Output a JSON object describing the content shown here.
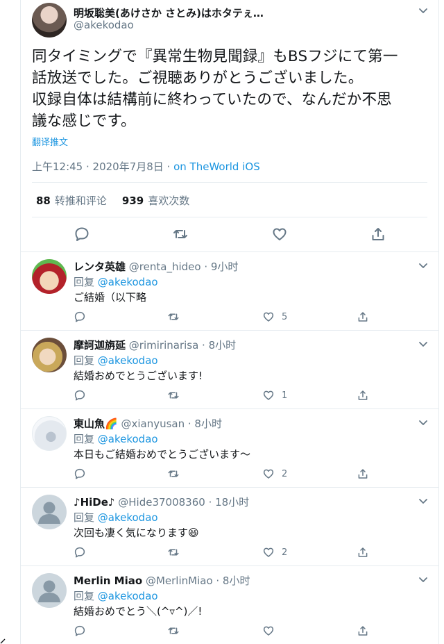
{
  "main_tweet": {
    "author_name": "明坂聡美(あけさか さとみ)はホタテぇ…",
    "author_handle": "@akekodao",
    "text_lines": [
      "同タイミングで『異常生物見聞録』もBSフジにて第一",
      "話放送でした。ご視聴ありがとうございました。",
      "収録自体は結構前に終わっていたので、なんだか不思",
      "議な感じです。"
    ],
    "translate_label": "翻译推文",
    "time": "上午12:45 · 2020年7月8日 · ",
    "via": "on TheWorld iOS",
    "retweets_count": "88",
    "retweets_label": "转推和评论",
    "likes_count": "939",
    "likes_label": "喜欢次数"
  },
  "replies": [
    {
      "name": "レンタ英雄",
      "handle": "@renta_hideo · 9小时",
      "reply_prefix": "回复 ",
      "mention": "@akekodao",
      "text": "ご結婚（以下略",
      "likes": "5",
      "avatar": "anime-avatar-red-hair"
    },
    {
      "name": "摩訶迦旃延",
      "handle": "@rimirinarisa · 8小时",
      "reply_prefix": "回复 ",
      "mention": "@akekodao",
      "text": "結婚おめでとうございます!",
      "likes": "1",
      "avatar": "anime-avatar-blonde"
    },
    {
      "name": "東山魚🌈",
      "handle": "@xianyusan · 8小时",
      "reply_prefix": "回复 ",
      "mention": "@akekodao",
      "text": "本日もご結婚おめでとうございます～",
      "likes": "2",
      "avatar": "photo-avatar-light"
    },
    {
      "name": "♪HiDe♪",
      "handle": "@Hide37008360 · 18小时",
      "reply_prefix": "回复 ",
      "mention": "@akekodao",
      "text": "次回も凄く気になります😆",
      "likes": "2",
      "avatar": "default-avatar"
    },
    {
      "name": "Merlin Miao",
      "handle": "@MerlinMiao · 8小时",
      "reply_prefix": "回复 ",
      "mention": "@akekodao",
      "text": "結婚おめでとう＼(^▿^)／!",
      "likes": "",
      "avatar": "default-avatar"
    }
  ],
  "colors": {
    "accent": "#1b95e0",
    "muted": "#657786",
    "text": "#14171a",
    "border": "#e6ecf0"
  }
}
